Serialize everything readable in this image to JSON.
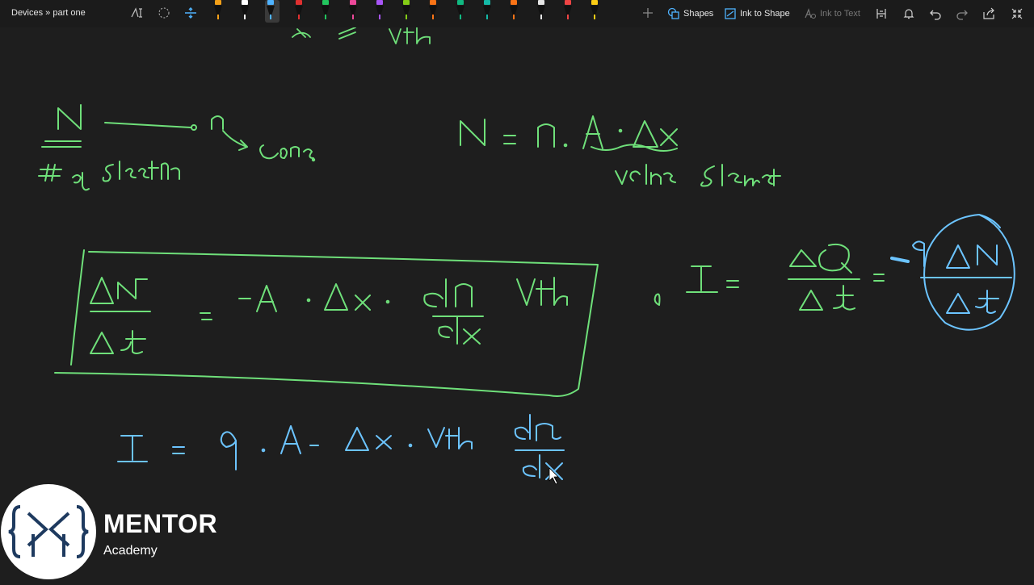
{
  "header": {
    "title": "Devices » part one"
  },
  "toolbar": {
    "pens": [
      {
        "color": "#f4a018"
      },
      {
        "color": "#ffffff"
      },
      {
        "color": "#4fb3ff"
      },
      {
        "color": "#e03030"
      },
      {
        "color": "#22c55e"
      },
      {
        "color": "#ec4899"
      },
      {
        "color": "#a855f7"
      },
      {
        "color": "#84cc16"
      },
      {
        "color": "#f97316"
      },
      {
        "color": "#10b981"
      },
      {
        "color": "#14b8a6"
      },
      {
        "color": "#f97316"
      },
      {
        "color": "#e5e5e5"
      },
      {
        "color": "#ef4444"
      },
      {
        "color": "#facc15"
      }
    ],
    "shapes_label": "Shapes",
    "ink_to_shape_label": "Ink to Shape",
    "ink_to_text_label": "Ink to Text"
  },
  "ink": {
    "green": "#6fe07a",
    "blue": "#6cc4ff"
  },
  "brand": {
    "name": "MENTOR",
    "sub": "Academy"
  }
}
